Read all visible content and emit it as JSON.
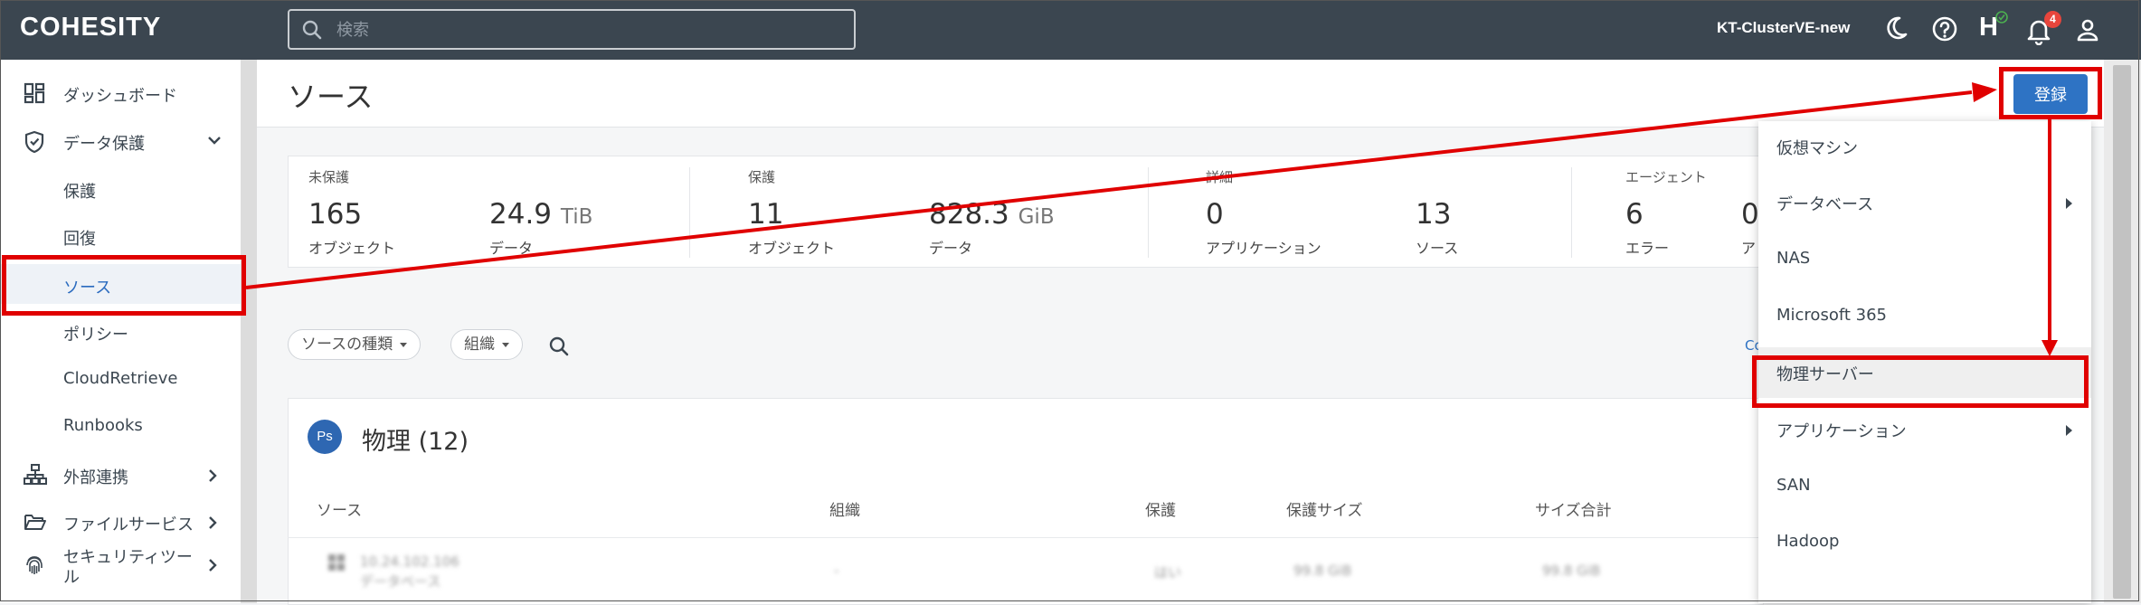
{
  "header": {
    "logo": "COHESITY",
    "search_placeholder": "検索",
    "cluster_name": "KT-ClusterVE-new",
    "notification_count": "4",
    "helios_letter": "H"
  },
  "sidebar": {
    "items": [
      {
        "label": "ダッシュボード"
      },
      {
        "label": "データ保護"
      },
      {
        "label": "保護"
      },
      {
        "label": "回復"
      },
      {
        "label": "ソース"
      },
      {
        "label": "ポリシー"
      },
      {
        "label": "CloudRetrieve"
      },
      {
        "label": "Runbooks"
      },
      {
        "label": "外部連携"
      },
      {
        "label": "ファイルサービス"
      },
      {
        "label": "セキュリティツール"
      }
    ]
  },
  "page": {
    "title": "ソース",
    "register_label": "登録"
  },
  "stats": {
    "groups": [
      {
        "label": "未保護",
        "v1": "165",
        "l1": "オブジェクト",
        "v2": "24.9",
        "u2": "TiB",
        "l2": "データ"
      },
      {
        "label": "保護",
        "v1": "11",
        "l1": "オブジェクト",
        "v2": "828.3",
        "u2": "GiB",
        "l2": "データ"
      },
      {
        "label": "詳細",
        "v1": "0",
        "l1": "アプリケーション",
        "v2": "13",
        "l2": "ソース"
      },
      {
        "label": "エージェント",
        "v1": "6",
        "l1": "エラー",
        "v2": "0",
        "l2": "ア"
      }
    ]
  },
  "filters": {
    "source_type": "ソースの種類",
    "organization": "組織",
    "partial_link": "Co"
  },
  "card": {
    "avatar": "Ps",
    "title": "物理 (12)",
    "columns": [
      "ソース",
      "組織",
      "保護",
      "保護サイズ",
      "サイズ合計"
    ],
    "row": {
      "name": "10.24.102.106",
      "type": "データベース",
      "org": "-",
      "protected": "はい",
      "protected_size": "99.8 GiB",
      "total_size": "99.8 GiB"
    }
  },
  "register_menu": {
    "items": [
      {
        "label": "仮想マシン"
      },
      {
        "label": "データベース"
      },
      {
        "label": "NAS"
      },
      {
        "label": "Microsoft 365"
      },
      {
        "label": "物理サーバー"
      },
      {
        "label": "アプリケーション"
      },
      {
        "label": "SAN"
      },
      {
        "label": "Hadoop"
      }
    ]
  },
  "colors": {
    "topbar": "#3b4650",
    "accent": "#2e73c4",
    "annotation": "#e00000"
  }
}
